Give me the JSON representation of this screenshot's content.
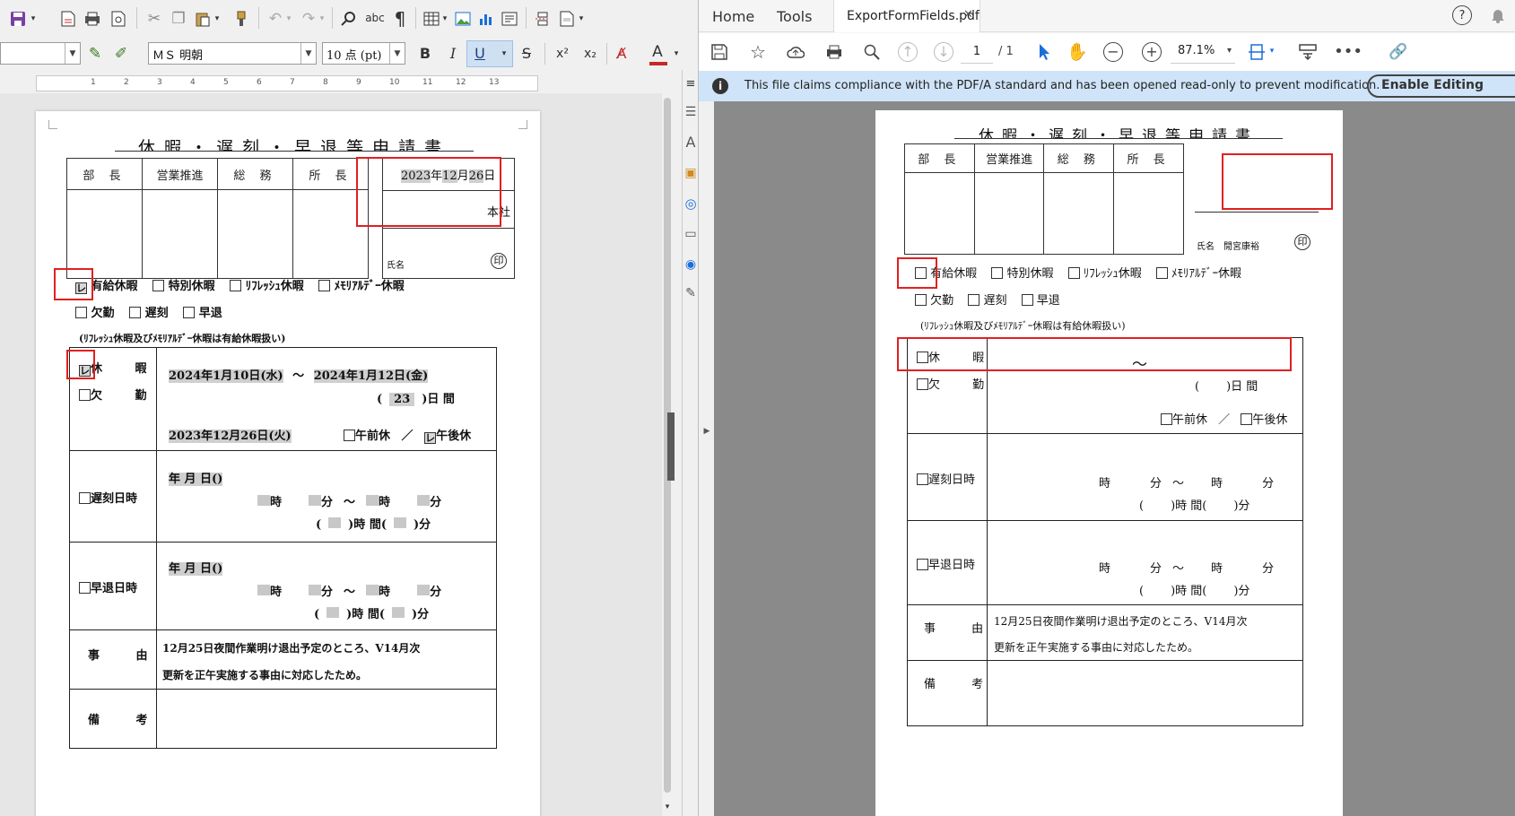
{
  "writer": {
    "font_name": "ＭＳ 明朝",
    "font_size": "10 点 (pt)",
    "format_buttons": {
      "bold": "B",
      "italic": "I",
      "underline": "U",
      "strike": "S",
      "superscript": "x²",
      "subscript": "x₂"
    },
    "ruler_marks": [
      "1",
      "2",
      "3",
      "4",
      "5",
      "6",
      "7",
      "8",
      "9",
      "10",
      "11",
      "12",
      "13"
    ],
    "sidebar_icons": [
      "styles-icon",
      "fontwork-icon",
      "gallery-icon",
      "navigator-icon",
      "page-icon",
      "inspect-icon",
      "manage-changes-icon"
    ]
  },
  "form": {
    "title": "休暇・遅刻・早退等申請書",
    "approvers": [
      "部 長",
      "営業推進",
      "総 務",
      "所 長"
    ],
    "date_field": {
      "year": "2023",
      "mon": "12",
      "day": "26",
      "label_year": "年",
      "label_mon": "月",
      "label_day": "日"
    },
    "branch": "本社",
    "name_label": "氏名",
    "seal": "印",
    "leave_types_row1": [
      "有給休暇",
      "特別休暇",
      "ﾘﾌﾚｯｼｭ休暇",
      "ﾒﾓﾘｱﾙﾃﾞｰ休暇"
    ],
    "leave_types_row2": [
      "欠勤",
      "遅刻",
      "早退"
    ],
    "note": "(ﾘﾌﾚｯｼｭ休暇及びﾒﾓﾘｱﾙﾃﾞｰ休暇は有給休暇扱い)",
    "check_mark": "レ",
    "vacation_label": "休 暇",
    "absence_label": "欠 勤",
    "vacation_period_from": "2024年1月10日(水)",
    "tilde": "〜",
    "vacation_period_to": "2024年1月12日(金)",
    "days_open": "(",
    "days": "23",
    "days_close": ")日 間",
    "request_date": "2023年12月26日(火)",
    "am_off": "午前休",
    "slash": "／",
    "pm_off": "午後休",
    "late_label": "遅刻日時",
    "early_label": "早退日時",
    "date_blank": "年 月 日()",
    "time_hour": "時",
    "time_min": "分",
    "duration_open": "(",
    "duration_hours": ")時 間(",
    "duration_min": ")分",
    "reason_label": "事 由",
    "reason_line1": "12月25日夜間作業明け退出予定のところ、V14月次",
    "reason_line2": "更新を正午実施する事由に対応したため。",
    "remarks_label": "備 考"
  },
  "pdf": {
    "tabs": [
      "Home",
      "Tools",
      "ExportFormFields.pdf"
    ],
    "page_current": "1",
    "page_total": "/ 1",
    "zoom": "87.1%",
    "banner": "This file claims compliance with the PDF/A standard and has been opened read-only to prevent modification.",
    "enable_editing": "Enable Editing",
    "name_value": "閒宮康裕",
    "days_blank": "(",
    "days_close_blank": ")日 間"
  },
  "colors": {
    "highlight_box": "#e02020",
    "banner_bg": "#cfe4f9",
    "accent_blue": "#1a6ed8",
    "field_gray": "#cfcfcf"
  }
}
